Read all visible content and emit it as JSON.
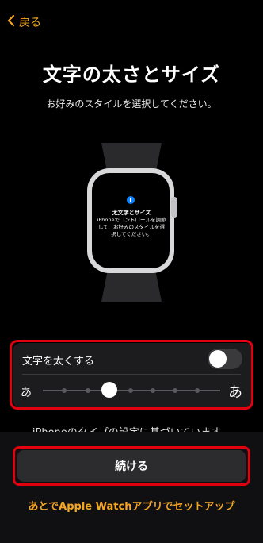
{
  "colors": {
    "accent": "#f5a623",
    "highlight": "#e3000f",
    "background": "#000000"
  },
  "nav": {
    "back_label": "戻る",
    "back_icon": "chevron-left-icon"
  },
  "header": {
    "title": "文字の太さとサイズ",
    "subtitle": "お好みのスタイルを選択してください。"
  },
  "watch": {
    "screen_title": "太文字とサイズ",
    "screen_text": "iPhoneでコントロールを調節して、お好みのスタイルを選択してください。",
    "icon": "info-icon"
  },
  "settings": {
    "bold_label": "文字を太くする",
    "bold_enabled": false,
    "size_small_glyph": "あ",
    "size_large_glyph": "あ",
    "size_level": 0.33
  },
  "note": "iPhoneのタイプの設定に基づいています。",
  "actions": {
    "continue_label": "続ける",
    "later_label": "あとでApple Watchアプリでセットアップ"
  }
}
